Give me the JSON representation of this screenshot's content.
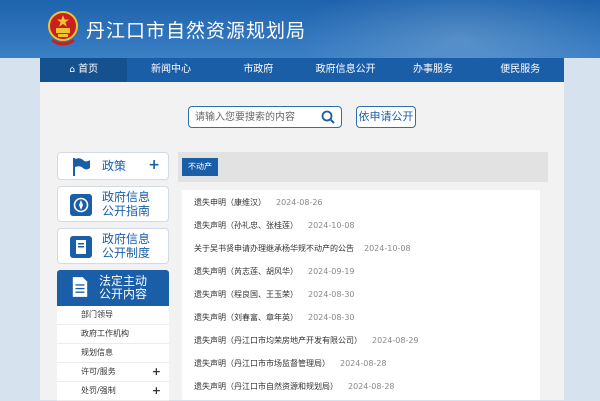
{
  "site": {
    "title": "丹江口市自然资源规划局"
  },
  "nav": {
    "items": [
      "首页",
      "新闻中心",
      "市政府",
      "政府信息公开",
      "办事服务",
      "便民服务"
    ]
  },
  "search": {
    "placeholder": "请输入您要搜索的内容",
    "apply_label": "依申请公开"
  },
  "sidebar": {
    "policy_label": "政策",
    "guide_label_1": "政府信息",
    "guide_label_2": "公开指南",
    "system_label_1": "政府信息",
    "system_label_2": "公开制度",
    "law_label_1": "法定主动",
    "law_label_2": "公开内容",
    "law_items": [
      {
        "label": "部门领导",
        "plus": false
      },
      {
        "label": "政府工作机构",
        "plus": false
      },
      {
        "label": "规划信息",
        "plus": false
      },
      {
        "label": "许可/服务",
        "plus": true
      },
      {
        "label": "处罚/强制",
        "plus": true
      }
    ]
  },
  "tab": {
    "active_label": "不动产"
  },
  "list": [
    {
      "title": "遗失申明（康维汉）",
      "date": "2024-08-26"
    },
    {
      "title": "遗失声明（孙礼忠、张桂莲）",
      "date": "2024-10-08"
    },
    {
      "title": "关于吴书贤申请办理继承杨华规不动产的公告",
      "date": "2024-10-08"
    },
    {
      "title": "遗失声明（芮志莲、胡风华）",
      "date": "2024-09-19"
    },
    {
      "title": "遗失声明（程良国、王玉荣）",
      "date": "2024-08-30"
    },
    {
      "title": "遗失声明（刘春富、章年英）",
      "date": "2024-08-30"
    },
    {
      "title": "遗失声明（丹江口市均荣房地产开发有限公司）",
      "date": "2024-08-29"
    },
    {
      "title": "遗失声明（丹江口市市场监督管理局）",
      "date": "2024-08-28"
    },
    {
      "title": "遗失声明（丹江口市自然资源和规划局）",
      "date": "2024-08-28"
    }
  ]
}
